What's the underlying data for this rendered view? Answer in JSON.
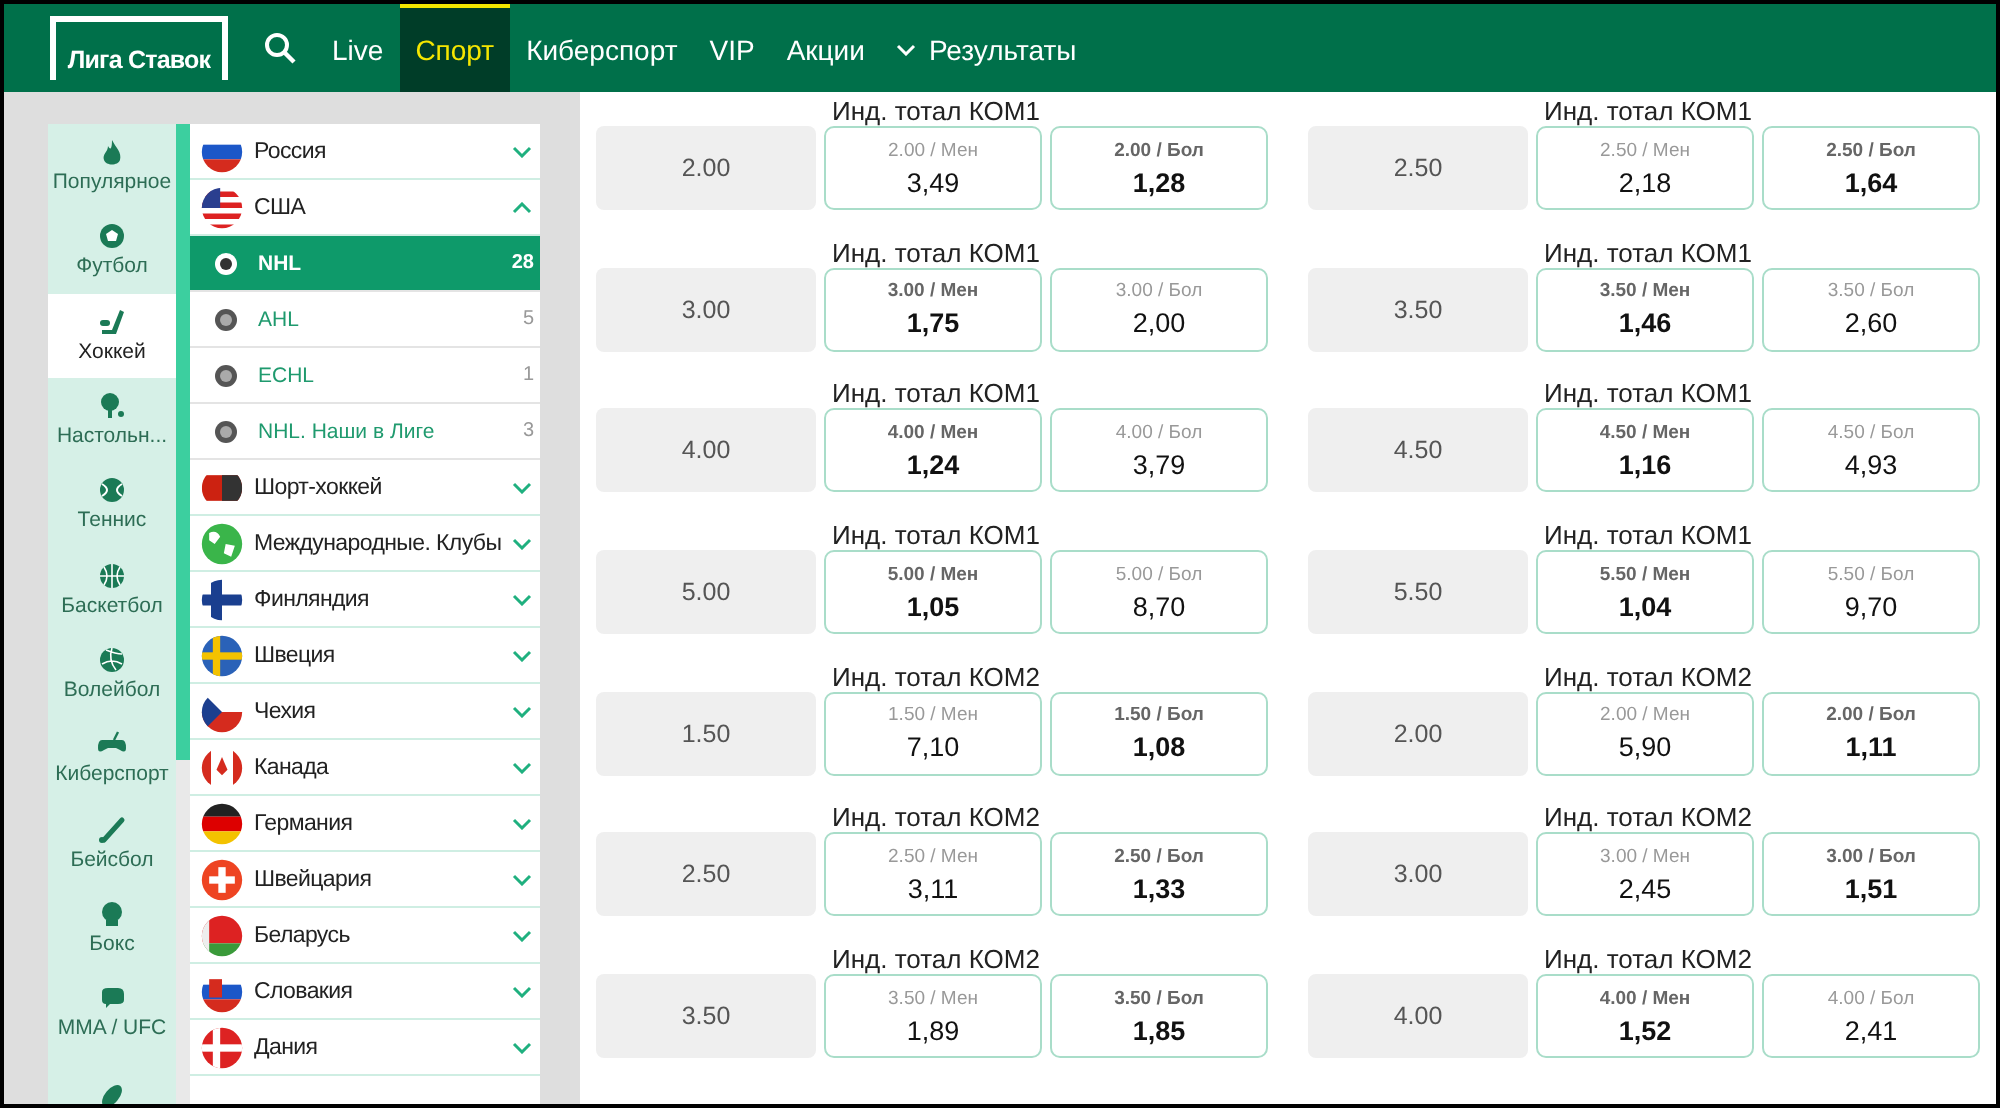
{
  "header": {
    "logo": "Лига Ставок",
    "nav": [
      {
        "label": "Live",
        "selected": false
      },
      {
        "label": "Спорт",
        "selected": true
      },
      {
        "label": "Киберспорт",
        "selected": false
      },
      {
        "label": "VIP",
        "selected": false
      },
      {
        "label": "Акции",
        "selected": false
      },
      {
        "label": "Результаты",
        "selected": false,
        "kind": "dropdown"
      }
    ]
  },
  "sports": [
    {
      "label": "Популярное",
      "selected": false
    },
    {
      "label": "Футбол",
      "selected": false
    },
    {
      "label": "Хоккей",
      "selected": true
    },
    {
      "label": "Настольн...",
      "selected": false
    },
    {
      "label": "Теннис",
      "selected": false
    },
    {
      "label": "Баскетбол",
      "selected": false
    },
    {
      "label": "Волейбол",
      "selected": false
    },
    {
      "label": "Киберспорт",
      "selected": false
    },
    {
      "label": "Бейсбол",
      "selected": false
    },
    {
      "label": "Бокс",
      "selected": false
    },
    {
      "label": "MMA / UFC",
      "selected": false
    }
  ],
  "countries": [
    {
      "name": "Россия",
      "expanded": false
    },
    {
      "name": "США",
      "expanded": true,
      "children": [
        {
          "name": "NHL",
          "count": "28",
          "selected": true
        },
        {
          "name": "AHL",
          "count": "5",
          "selected": false
        },
        {
          "name": "ECHL",
          "count": "1",
          "selected": false
        },
        {
          "name": "NHL. Наши в Лиге",
          "count": "3",
          "selected": false
        }
      ]
    },
    {
      "name": "Шорт-хоккей",
      "expanded": false
    },
    {
      "name": "Международные. Клубы",
      "expanded": false
    },
    {
      "name": "Финляндия",
      "expanded": false
    },
    {
      "name": "Швеция",
      "expanded": false
    },
    {
      "name": "Чехия",
      "expanded": false
    },
    {
      "name": "Канада",
      "expanded": false
    },
    {
      "name": "Германия",
      "expanded": false
    },
    {
      "name": "Швейцария",
      "expanded": false
    },
    {
      "name": "Беларусь",
      "expanded": false
    },
    {
      "name": "Словакия",
      "expanded": false
    },
    {
      "name": "Дания",
      "expanded": false
    }
  ],
  "markets": [
    {
      "title": "Инд. тотал КОМ1",
      "line": "2.00",
      "outcomes": [
        {
          "label": "2.00 / Мен",
          "odds": "3,49",
          "highlighted": false
        },
        {
          "label": "2.00 / Бол",
          "odds": "1,28",
          "highlighted": true
        }
      ]
    },
    {
      "title": "Инд. тотал КОМ1",
      "line": "2.50",
      "outcomes": [
        {
          "label": "2.50 / Мен",
          "odds": "2,18",
          "highlighted": false
        },
        {
          "label": "2.50 / Бол",
          "odds": "1,64",
          "highlighted": true
        }
      ]
    },
    {
      "title": "Инд. тотал КОМ1",
      "line": "3.00",
      "outcomes": [
        {
          "label": "3.00 / Мен",
          "odds": "1,75",
          "highlighted": true
        },
        {
          "label": "3.00 / Бол",
          "odds": "2,00",
          "highlighted": false
        }
      ]
    },
    {
      "title": "Инд. тотал КОМ1",
      "line": "3.50",
      "outcomes": [
        {
          "label": "3.50 / Мен",
          "odds": "1,46",
          "highlighted": true
        },
        {
          "label": "3.50 / Бол",
          "odds": "2,60",
          "highlighted": false
        }
      ]
    },
    {
      "title": "Инд. тотал КОМ1",
      "line": "4.00",
      "outcomes": [
        {
          "label": "4.00 / Мен",
          "odds": "1,24",
          "highlighted": true
        },
        {
          "label": "4.00 / Бол",
          "odds": "3,79",
          "highlighted": false
        }
      ]
    },
    {
      "title": "Инд. тотал КОМ1",
      "line": "4.50",
      "outcomes": [
        {
          "label": "4.50 / Мен",
          "odds": "1,16",
          "highlighted": true
        },
        {
          "label": "4.50 / Бол",
          "odds": "4,93",
          "highlighted": false
        }
      ]
    },
    {
      "title": "Инд. тотал КОМ1",
      "line": "5.00",
      "outcomes": [
        {
          "label": "5.00 / Мен",
          "odds": "1,05",
          "highlighted": true
        },
        {
          "label": "5.00 / Бол",
          "odds": "8,70",
          "highlighted": false
        }
      ]
    },
    {
      "title": "Инд. тотал КОМ1",
      "line": "5.50",
      "outcomes": [
        {
          "label": "5.50 / Мен",
          "odds": "1,04",
          "highlighted": true
        },
        {
          "label": "5.50 / Бол",
          "odds": "9,70",
          "highlighted": false
        }
      ]
    },
    {
      "title": "Инд. тотал КОМ2",
      "line": "1.50",
      "outcomes": [
        {
          "label": "1.50 / Мен",
          "odds": "7,10",
          "highlighted": false
        },
        {
          "label": "1.50 / Бол",
          "odds": "1,08",
          "highlighted": true
        }
      ]
    },
    {
      "title": "Инд. тотал КОМ2",
      "line": "2.00",
      "outcomes": [
        {
          "label": "2.00 / Мен",
          "odds": "5,90",
          "highlighted": false
        },
        {
          "label": "2.00 / Бол",
          "odds": "1,11",
          "highlighted": true
        }
      ]
    },
    {
      "title": "Инд. тотал КОМ2",
      "line": "2.50",
      "outcomes": [
        {
          "label": "2.50 / Мен",
          "odds": "3,11",
          "highlighted": false
        },
        {
          "label": "2.50 / Бол",
          "odds": "1,33",
          "highlighted": true
        }
      ]
    },
    {
      "title": "Инд. тотал КОМ2",
      "line": "3.00",
      "outcomes": [
        {
          "label": "3.00 / Мен",
          "odds": "2,45",
          "highlighted": false
        },
        {
          "label": "3.00 / Бол",
          "odds": "1,51",
          "highlighted": true
        }
      ]
    },
    {
      "title": "Инд. тотал КОМ2",
      "line": "3.50",
      "outcomes": [
        {
          "label": "3.50 / Мен",
          "odds": "1,89",
          "highlighted": false
        },
        {
          "label": "3.50 / Бол",
          "odds": "1,85",
          "highlighted": true
        }
      ]
    },
    {
      "title": "Инд. тотал КОМ2",
      "line": "4.00",
      "outcomes": [
        {
          "label": "4.00 / Мен",
          "odds": "1,52",
          "highlighted": true
        },
        {
          "label": "4.00 / Бол",
          "odds": "2,41",
          "highlighted": false
        }
      ]
    }
  ]
}
